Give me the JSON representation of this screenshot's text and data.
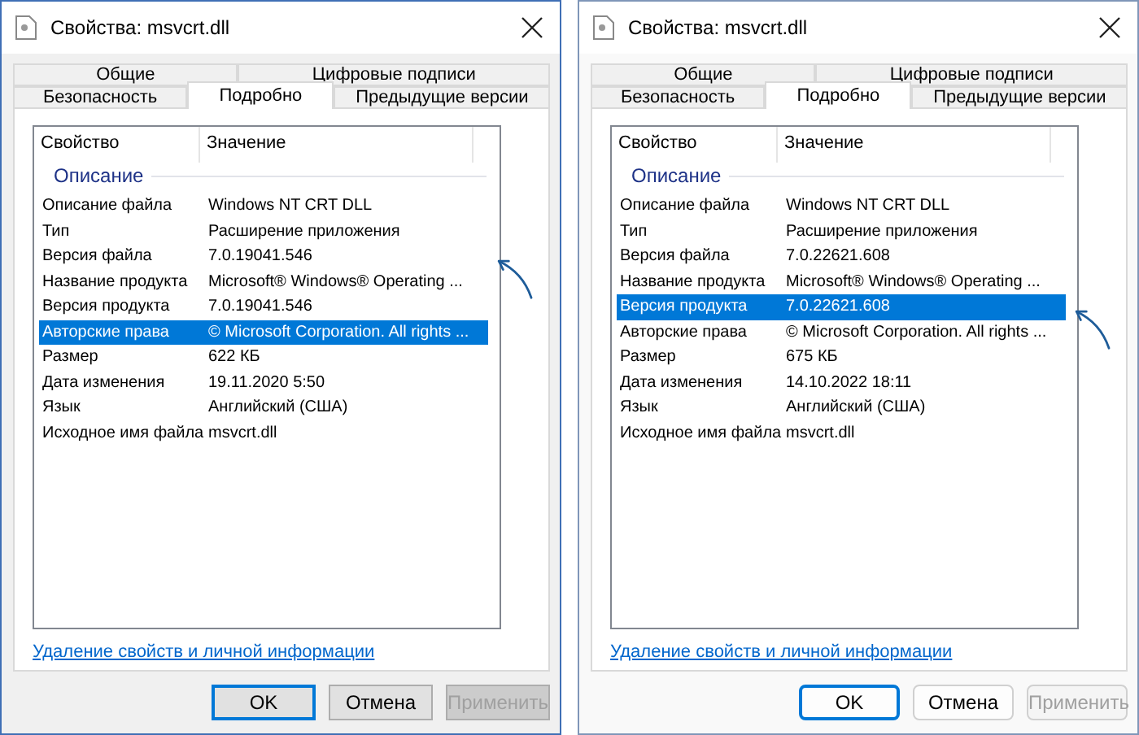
{
  "windows": [
    {
      "kind": "win10",
      "title": "Свойства: msvcrt.dll",
      "tab_rows": [
        [
          {
            "label": "Общие",
            "selected": false
          },
          {
            "label": "Цифровые подписи",
            "selected": false
          }
        ],
        [
          {
            "label": "Безопасность",
            "selected": false
          },
          {
            "label": "Подробно",
            "selected": true
          },
          {
            "label": "Предыдущие версии",
            "selected": false
          }
        ]
      ],
      "columns": [
        "Свойство",
        "Значение"
      ],
      "group": "Описание",
      "rows": [
        {
          "property": "Описание файла",
          "value": "Windows NT CRT DLL",
          "selected": false
        },
        {
          "property": "Тип",
          "value": "Расширение приложения",
          "selected": false
        },
        {
          "property": "Версия файла",
          "value": "7.0.19041.546",
          "selected": false,
          "arrow": true
        },
        {
          "property": "Название продукта",
          "value": "Microsoft® Windows® Operating ...",
          "selected": false
        },
        {
          "property": "Версия продукта",
          "value": "7.0.19041.546",
          "selected": false
        },
        {
          "property": "Авторские права",
          "value": "© Microsoft Corporation. All rights ...",
          "selected": true
        },
        {
          "property": "Размер",
          "value": "622 КБ",
          "selected": false
        },
        {
          "property": "Дата изменения",
          "value": "19.11.2020 5:50",
          "selected": false
        },
        {
          "property": "Язык",
          "value": "Английский (США)",
          "selected": false
        },
        {
          "property": "Исходное имя файла",
          "value": "msvcrt.dll",
          "selected": false
        }
      ],
      "link": "Удаление свойств и личной информации",
      "buttons": [
        {
          "label": "OK",
          "default": true,
          "disabled": false
        },
        {
          "label": "Отмена",
          "default": false,
          "disabled": false
        },
        {
          "label": "Применить",
          "default": false,
          "disabled": true
        }
      ]
    },
    {
      "kind": "win11",
      "title": "Свойства: msvcrt.dll",
      "tab_rows": [
        [
          {
            "label": "Общие",
            "selected": false
          },
          {
            "label": "Цифровые подписи",
            "selected": false
          }
        ],
        [
          {
            "label": "Безопасность",
            "selected": false
          },
          {
            "label": "Подробно",
            "selected": true
          },
          {
            "label": "Предыдущие версии",
            "selected": false
          }
        ]
      ],
      "columns": [
        "Свойство",
        "Значение"
      ],
      "group": "Описание",
      "rows": [
        {
          "property": "Описание файла",
          "value": "Windows NT CRT DLL",
          "selected": false
        },
        {
          "property": "Тип",
          "value": "Расширение приложения",
          "selected": false
        },
        {
          "property": "Версия файла",
          "value": "7.0.22621.608",
          "selected": false
        },
        {
          "property": "Название продукта",
          "value": "Microsoft® Windows® Operating ...",
          "selected": false
        },
        {
          "property": "Версия продукта",
          "value": "7.0.22621.608",
          "selected": true,
          "arrow": true
        },
        {
          "property": "Авторские права",
          "value": "© Microsoft Corporation. All rights ...",
          "selected": false
        },
        {
          "property": "Размер",
          "value": "675 КБ",
          "selected": false
        },
        {
          "property": "Дата изменения",
          "value": "14.10.2022 18:11",
          "selected": false
        },
        {
          "property": "Язык",
          "value": "Английский (США)",
          "selected": false
        },
        {
          "property": "Исходное имя файла",
          "value": "msvcrt.dll",
          "selected": false
        }
      ],
      "link": "Удаление свойств и личной информации",
      "buttons": [
        {
          "label": "OK",
          "default": true,
          "disabled": false
        },
        {
          "label": "Отмена",
          "default": false,
          "disabled": false
        },
        {
          "label": "Применить",
          "default": false,
          "disabled": true
        }
      ]
    }
  ]
}
